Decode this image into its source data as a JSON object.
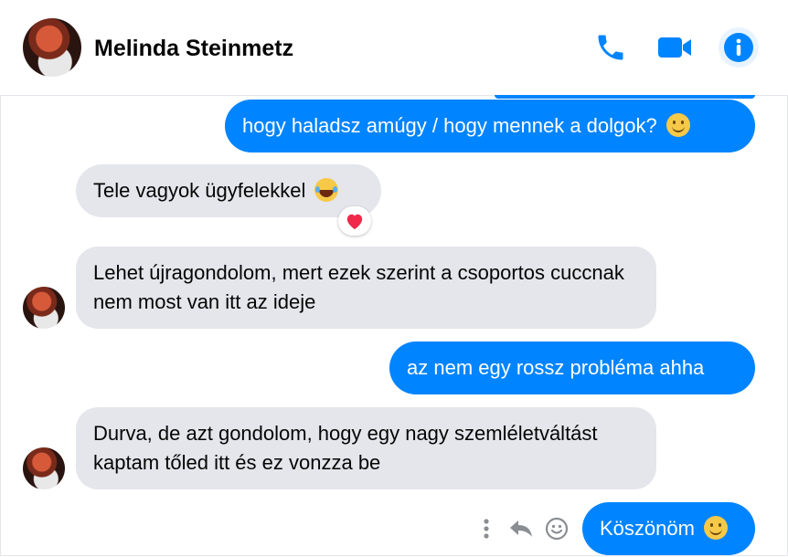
{
  "header": {
    "contact_name": "Melinda Steinmetz",
    "icons": [
      "phone-icon",
      "video-camera-icon",
      "info-icon"
    ]
  },
  "colors": {
    "accent": "#0084ff",
    "incoming_bubble": "#e4e6eb",
    "info_button_bg": "#e7f3ff"
  },
  "messages": [
    {
      "direction": "outgoing",
      "text": "hogy haladsz amúgy / hogy mennek a dolgok?",
      "emoji": "slightly-smiling-face"
    },
    {
      "direction": "incoming",
      "text": "Tele vagyok ügyfelekkel",
      "emoji": "tears-of-joy-face",
      "reaction": "heart"
    },
    {
      "direction": "incoming",
      "text": "Lehet újragondolom, mert ezek szerint a csoportos cuccnak nem most van itt az ideje"
    },
    {
      "direction": "outgoing",
      "text": "az nem egy rossz probléma ahha"
    },
    {
      "direction": "incoming",
      "text": "Durva, de azt gondolom, hogy egy nagy szemléletváltást kaptam tőled itt és ez vonzza be"
    },
    {
      "direction": "outgoing",
      "text": "Köszönöm",
      "emoji": "slightly-smiling-face"
    }
  ],
  "message_actions": [
    "more-icon",
    "reply-icon",
    "react-icon"
  ]
}
